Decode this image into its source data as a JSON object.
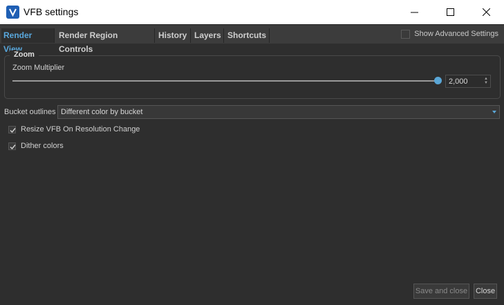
{
  "window": {
    "title": "VFB settings"
  },
  "tabs": [
    {
      "label": "Render View",
      "active": true
    },
    {
      "label": "Render Region Controls"
    },
    {
      "label": "History"
    },
    {
      "label": "Layers"
    },
    {
      "label": "Shortcuts"
    }
  ],
  "advanced": {
    "label": "Show Advanced Settings",
    "checked": false
  },
  "zoom": {
    "group_title": "Zoom",
    "multiplier_label": "Zoom Multiplier",
    "value": "2,000",
    "slider_fraction": 1.0
  },
  "bucket": {
    "label": "Bucket outlines",
    "selected": "Different color by bucket"
  },
  "checkboxes": [
    {
      "label": "Resize VFB On Resolution Change",
      "checked": true
    },
    {
      "label": "Dither colors",
      "checked": true
    }
  ],
  "buttons": {
    "save_close": "Save and close",
    "close": "Close"
  },
  "colors": {
    "accent": "#59a8dd",
    "background": "#2e2e2e",
    "tabbar": "#3c3c3c"
  }
}
